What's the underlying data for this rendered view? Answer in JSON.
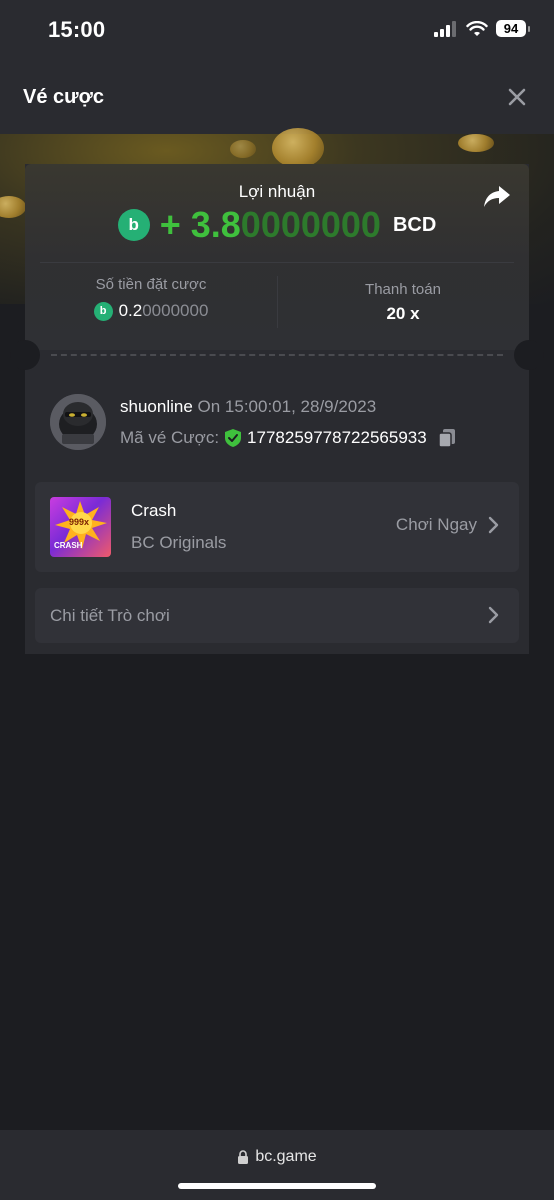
{
  "status_bar": {
    "time": "15:00",
    "battery": "94"
  },
  "header": {
    "title": "Vé cược"
  },
  "card": {
    "profit_label": "Lợi nhuận",
    "profit_sign": "+",
    "profit_amount_main": "3.8",
    "profit_amount_trailing": "0000000",
    "profit_currency": "BCD",
    "bet_amount_label": "Số tiền đặt cược",
    "bet_amount_main": "0.2",
    "bet_amount_trailing": "0000000",
    "payout_label": "Thanh toán",
    "payout_value": "20 x"
  },
  "user": {
    "name": "shuonline",
    "time": "On 15:00:01, 28/9/2023",
    "ticket_label": "Mã vé Cược:",
    "ticket_id": "1778259778722565933"
  },
  "game": {
    "name": "Crash",
    "provider": "BC Originals",
    "play_label": "Chơi Ngay",
    "thumb_badge": "999x",
    "thumb_title": "CRASH"
  },
  "details": {
    "label": "Chi tiết Trò chơi"
  },
  "browser": {
    "url": "bc.game"
  },
  "colors": {
    "accent_green": "#3fc03d",
    "coin_green": "#25b075",
    "background": "#1c1d21"
  }
}
